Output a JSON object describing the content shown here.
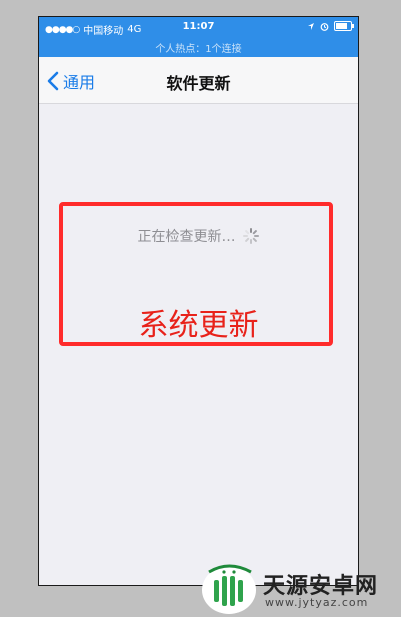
{
  "status_bar": {
    "signal": "●●●●○",
    "carrier": "中国移动",
    "network": "4G",
    "time": "11:07",
    "hotspot": "个人热点：1个连接"
  },
  "nav": {
    "back_label": "通用",
    "title": "软件更新"
  },
  "content": {
    "checking_text": "正在检查更新…",
    "annotation": "系统更新"
  },
  "watermark": {
    "brand": "天源安卓网",
    "url": "www.jytyaz.com"
  },
  "colors": {
    "status_bar_bg": "#2f8ee8",
    "link_blue": "#1a7ce8",
    "annotation_red": "#e8221a",
    "page_bg": "#efeff4"
  },
  "icons": {
    "back": "chevron-left-icon",
    "spinner": "activity-spinner-icon",
    "wifi": "wifi-icon",
    "location": "location-icon",
    "alarm": "alarm-icon",
    "battery": "battery-icon",
    "logo": "android-logo-icon"
  }
}
